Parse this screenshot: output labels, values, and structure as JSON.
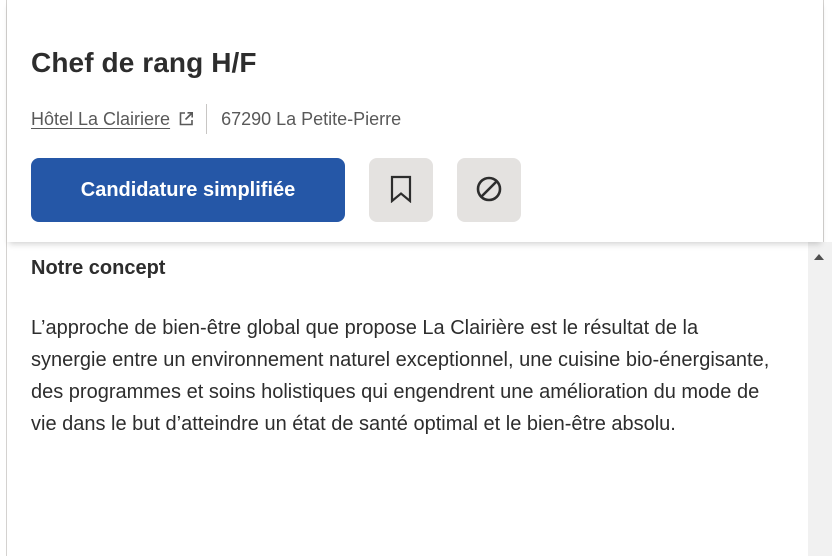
{
  "job": {
    "title": "Chef de rang H/F",
    "company": "Hôtel La Clairiere",
    "location": "67290 La Petite-Pierre"
  },
  "actions": {
    "apply_label": "Candidature simplifiée",
    "save_icon": "bookmark-icon",
    "not_interested_icon": "not-interested-icon"
  },
  "description": {
    "section_title": "Notre concept",
    "text": "L’approche de bien-être global que propose La Clairière est le résultat de la synergie entre un environnement naturel exceptionnel, une cuisine bio-énergisante, des programmes et soins holistiques qui engendrent une amélioration du mode de vie dans le but d’atteindre un état de santé optimal et le bien-être absolu."
  },
  "colors": {
    "primary": "#2557a7",
    "icon_button_bg": "#e4e2e0",
    "text": "#2d2d2d",
    "muted_text": "#595959"
  }
}
